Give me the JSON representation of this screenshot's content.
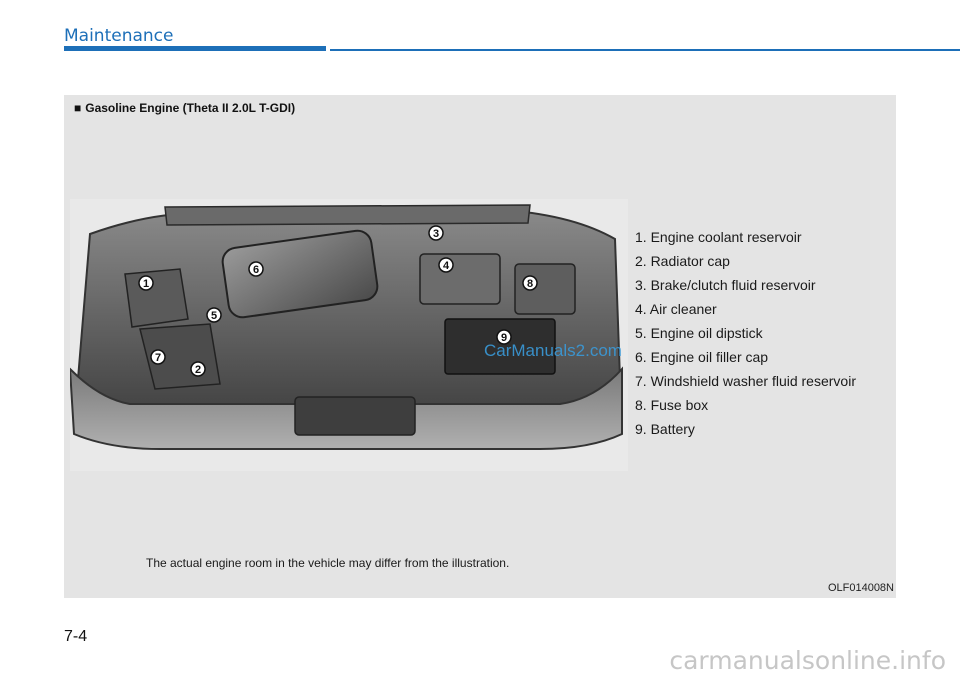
{
  "header": {
    "section_title": "Maintenance"
  },
  "figure": {
    "heading_marker": "■",
    "heading": "Gasoline Engine (Theta II 2.0L T-GDI)",
    "callouts": [
      "1",
      "2",
      "3",
      "4",
      "5",
      "6",
      "7",
      "8",
      "9"
    ],
    "legend": [
      "1. Engine coolant reservoir",
      "2. Radiator cap",
      "3. Brake/clutch fluid reservoir",
      "4. Air cleaner",
      "5. Engine oil dipstick",
      "6. Engine oil filler cap",
      "7. Windshield washer fluid reservoir",
      "8. Fuse box",
      "9. Battery"
    ],
    "disclaimer": "The actual engine room in the vehicle may differ from the illustration.",
    "code": "OLF014008N",
    "watermark": "CarManuals2.com"
  },
  "footer": {
    "page_number": "7-4",
    "watermark": "carmanualsonline.info"
  }
}
